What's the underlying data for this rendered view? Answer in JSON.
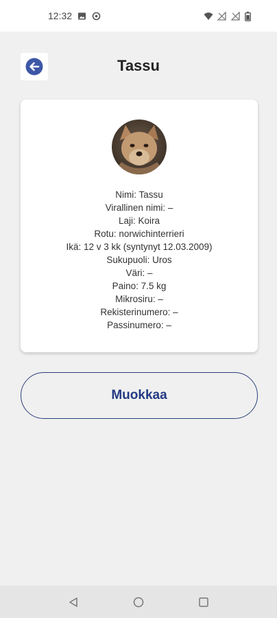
{
  "status_bar": {
    "time": "12:32",
    "icons": [
      "image-icon",
      "sync-icon",
      "wifi-icon",
      "signal-off-icon",
      "signal-off-icon",
      "battery-icon"
    ]
  },
  "header": {
    "title": "Tassu",
    "back_icon": "arrow-left-circle-icon"
  },
  "profile": {
    "avatar": "dog-photo",
    "fields": [
      "Nimi: Tassu",
      "Virallinen nimi: –",
      "Laji: Koira",
      "Rotu: norwichinterrieri",
      "Ikä: 12 v 3 kk  (syntynyt 12.03.2009)",
      "Sukupuoli: Uros",
      "Väri: –",
      "Paino: 7.5 kg",
      "Mikrosiru: –",
      "Rekisterinumero: –",
      "Passinumero: –"
    ]
  },
  "actions": {
    "edit_label": "Muokkaa"
  },
  "nav_bar": {
    "buttons": [
      "back-triangle-icon",
      "home-circle-icon",
      "recents-square-icon"
    ]
  },
  "colors": {
    "accent": "#233a82",
    "back_icon": "#3d57a6",
    "background": "#f0f0f0"
  }
}
